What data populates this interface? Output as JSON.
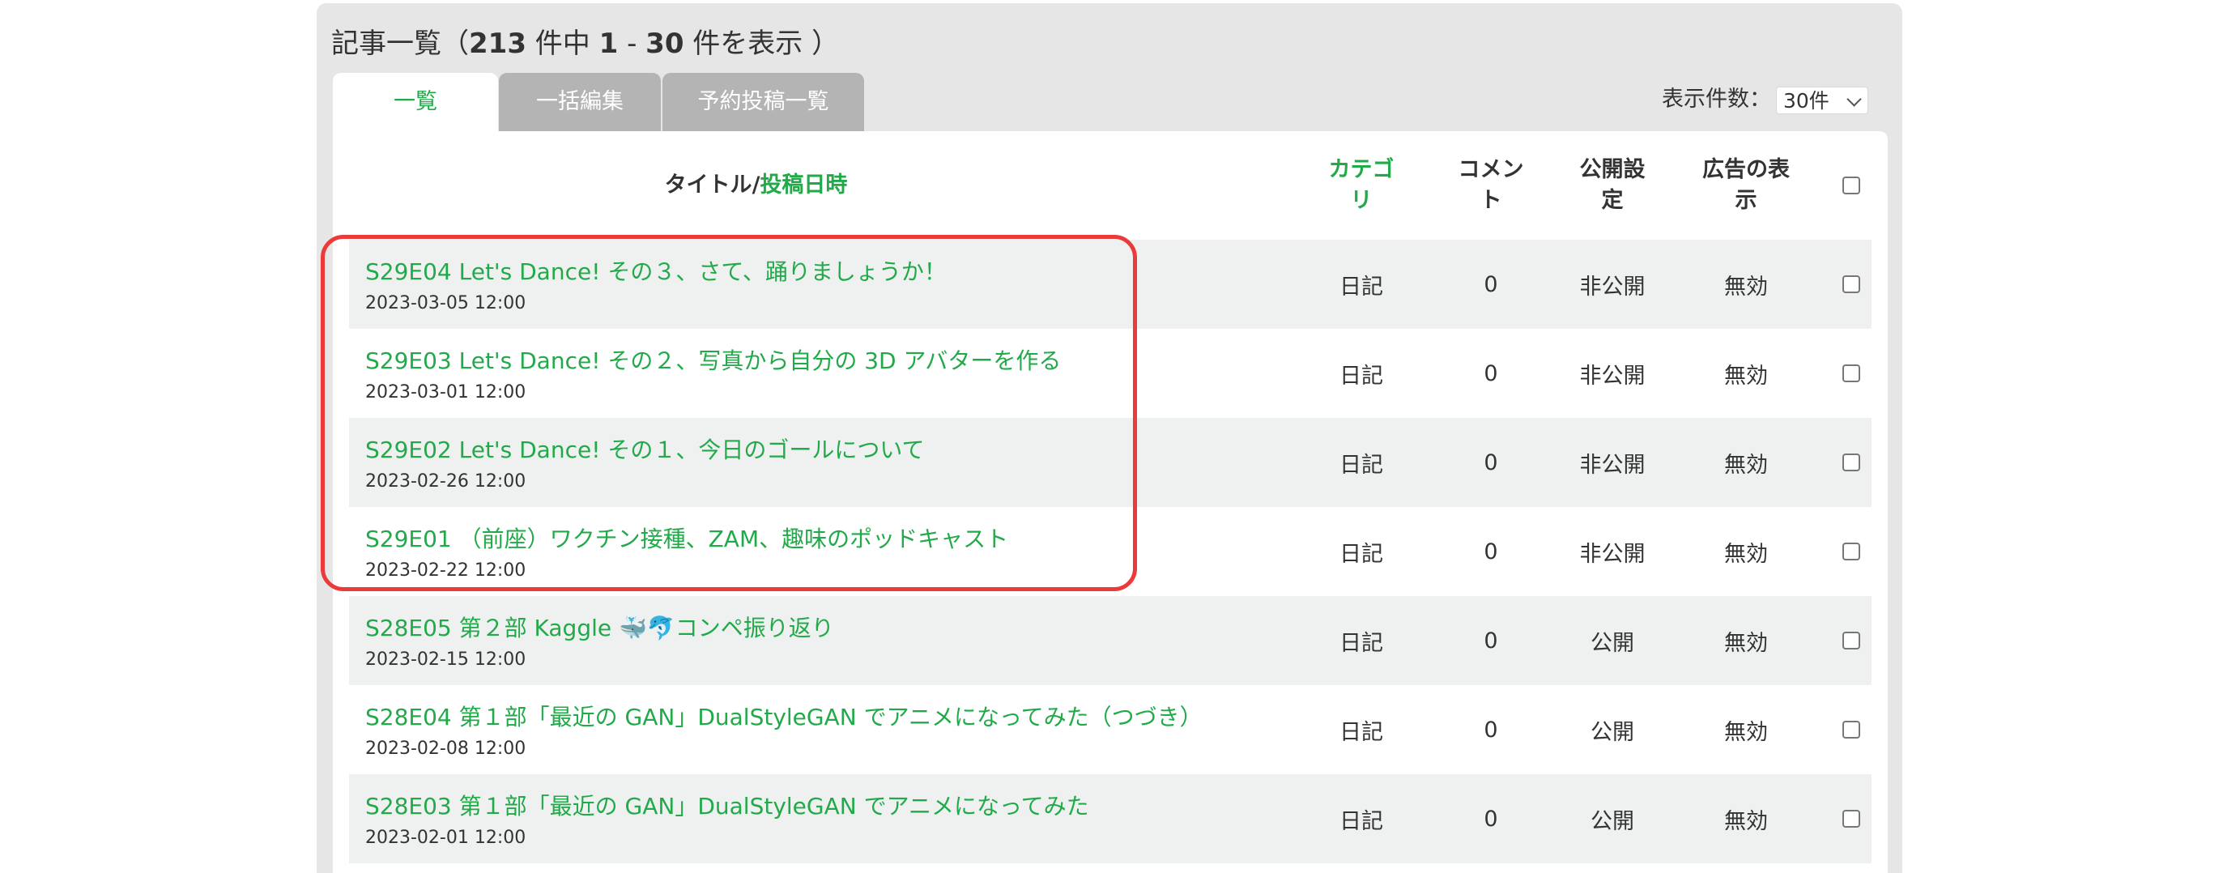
{
  "heading": {
    "prefix": "記事一覧（",
    "total": "213",
    "mid1": " 件中 ",
    "from": "1",
    "dash": " - ",
    "to": "30",
    "suffix": " 件を表示 ）"
  },
  "tabs": [
    {
      "label": "一覧",
      "active": true
    },
    {
      "label": "一括編集",
      "active": false
    },
    {
      "label": "予約投稿一覧",
      "active": false
    }
  ],
  "per_page": {
    "label": "表示件数：",
    "selected": "30件"
  },
  "columns": {
    "title": "タイトル",
    "title_sep": " / ",
    "posted": "投稿日時",
    "category_1": "カテゴ",
    "category_2": "リ",
    "comment_1": "コメン",
    "comment_2": "ト",
    "visibility_1": "公開設",
    "visibility_2": "定",
    "ads_1": "広告の表",
    "ads_2": "示"
  },
  "rows": [
    {
      "title": "S29E04 Let's Dance! その３、さて、踊りましょうか！",
      "date": "2023-03-05 12:00",
      "category": "日記",
      "comments": "0",
      "visibility": "非公開",
      "ads": "無効"
    },
    {
      "title": "S29E03 Let's Dance! その２、写真から自分の 3D アバターを作る",
      "date": "2023-03-01 12:00",
      "category": "日記",
      "comments": "0",
      "visibility": "非公開",
      "ads": "無効"
    },
    {
      "title": "S29E02 Let's Dance! その１、今日のゴールについて",
      "date": "2023-02-26 12:00",
      "category": "日記",
      "comments": "0",
      "visibility": "非公開",
      "ads": "無効"
    },
    {
      "title": "S29E01 （前座）ワクチン接種、ZAM、趣味のポッドキャスト",
      "date": "2023-02-22 12:00",
      "category": "日記",
      "comments": "0",
      "visibility": "非公開",
      "ads": "無効"
    },
    {
      "title": "S28E05 第２部 Kaggle 🐳🐬コンペ振り返り",
      "date": "2023-02-15 12:00",
      "category": "日記",
      "comments": "0",
      "visibility": "公開",
      "ads": "無効"
    },
    {
      "title": "S28E04 第１部「最近の GAN」DualStyleGAN でアニメになってみた（つづき）",
      "date": "2023-02-08 12:00",
      "category": "日記",
      "comments": "0",
      "visibility": "公開",
      "ads": "無効"
    },
    {
      "title": "S28E03 第１部「最近の GAN」DualStyleGAN でアニメになってみた",
      "date": "2023-02-01 12:00",
      "category": "日記",
      "comments": "0",
      "visibility": "公開",
      "ads": "無効"
    }
  ],
  "colors": {
    "link": "#22aa4a",
    "highlight": "#ea3a3a"
  }
}
